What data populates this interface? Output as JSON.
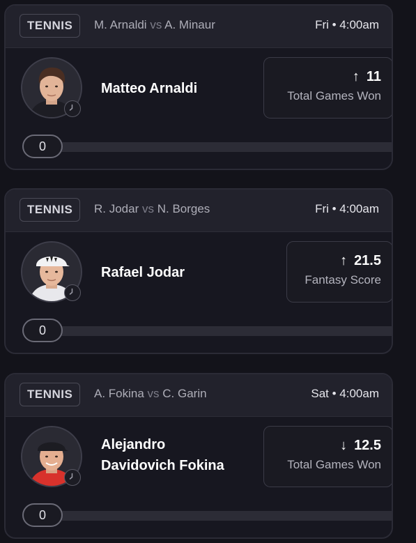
{
  "cards": [
    {
      "sport": "TENNIS",
      "team_a": "M. Arnaldi",
      "vs": "vs",
      "team_b": "A. Minaur",
      "time": "Fri • 4:00am",
      "player_name": "Matteo Arnaldi",
      "direction": "up",
      "arrow": "↑",
      "line": "11",
      "stat": "Total Games Won",
      "progress_value": "0",
      "progress_fraction": 0
    },
    {
      "sport": "TENNIS",
      "team_a": "R. Jodar",
      "vs": "vs",
      "team_b": "N. Borges",
      "time": "Fri • 4:00am",
      "player_name": "Rafael Jodar",
      "direction": "up",
      "arrow": "↑",
      "line": "21.5",
      "stat": "Fantasy Score",
      "progress_value": "0",
      "progress_fraction": 0
    },
    {
      "sport": "TENNIS",
      "team_a": "A. Fokina",
      "vs": "vs",
      "team_b": "C. Garin",
      "time": "Sat • 4:00am",
      "player_name_line1": "Alejandro",
      "player_name_line2": "Davidovich Fokina",
      "direction": "down",
      "arrow": "↓",
      "line": "12.5",
      "stat": "Total Games Won",
      "progress_value": "0",
      "progress_fraction": 0
    }
  ],
  "icons": {
    "avatar": "player-headshot",
    "clock": "clock-icon",
    "up": "arrow-up-icon",
    "down": "arrow-down-icon"
  },
  "colors": {
    "background": "#13131a",
    "card": "#171720",
    "header": "#22222c"
  }
}
